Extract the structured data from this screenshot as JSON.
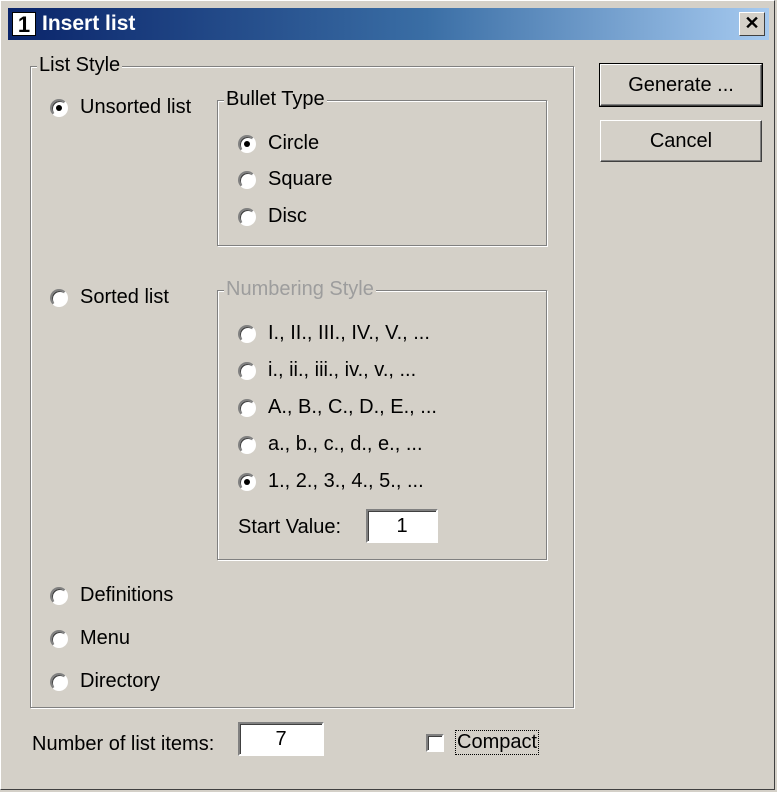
{
  "window": {
    "title": "Insert list",
    "app_icon_text": "1",
    "close_glyph": "✕"
  },
  "buttons": {
    "generate": "Generate ...",
    "cancel": "Cancel"
  },
  "list_style": {
    "legend": "List Style",
    "options": [
      {
        "label": "Unsorted list",
        "checked": true
      },
      {
        "label": "Sorted list",
        "checked": false
      },
      {
        "label": "Definitions",
        "checked": false
      },
      {
        "label": "Menu",
        "checked": false
      },
      {
        "label": "Directory",
        "checked": false
      }
    ]
  },
  "bullet_type": {
    "legend": "Bullet Type",
    "options": [
      {
        "label": "Circle",
        "checked": true
      },
      {
        "label": "Square",
        "checked": false
      },
      {
        "label": "Disc",
        "checked": false
      }
    ]
  },
  "numbering_style": {
    "legend": "Numbering Style",
    "options": [
      {
        "label": "I., II., III., IV., V., ...",
        "checked": false
      },
      {
        "label": "i., ii., iii., iv., v., ...",
        "checked": false
      },
      {
        "label": "A., B., C., D., E., ...",
        "checked": false
      },
      {
        "label": "a., b., c., d., e., ...",
        "checked": false
      },
      {
        "label": "1., 2., 3., 4., 5., ...",
        "checked": true
      }
    ],
    "start_value_label": "Start Value:",
    "start_value": "1"
  },
  "footer": {
    "num_items_label": "Number of list items:",
    "num_items_value": "7",
    "compact_label": "Compact",
    "compact_checked": false
  }
}
